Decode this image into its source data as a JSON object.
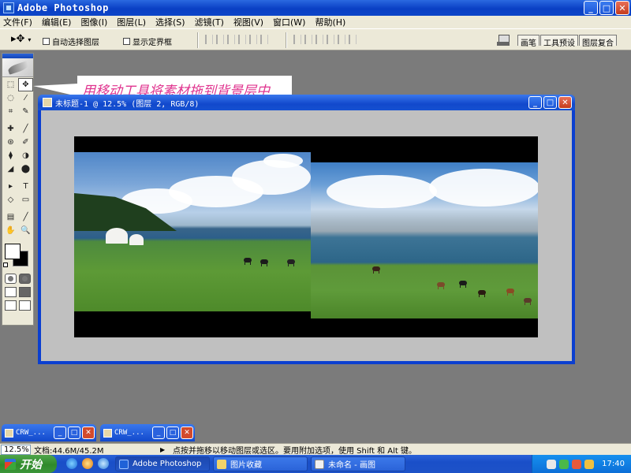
{
  "app": {
    "title": "Adobe Photoshop"
  },
  "window_buttons": {
    "minimize": "_",
    "maximize": "□",
    "close": "✕"
  },
  "menu": [
    "文件(F)",
    "编辑(E)",
    "图像(I)",
    "图层(L)",
    "选择(S)",
    "滤镜(T)",
    "视图(V)",
    "窗口(W)",
    "帮助(H)"
  ],
  "options_bar": {
    "tool_glyph": "▸✥",
    "dropdown_arrow": "▾",
    "auto_select_label": "自动选择图层",
    "show_bounds_label": "显示定界框",
    "dock_tabs": [
      "画笔",
      "工具预设",
      "图层复合"
    ]
  },
  "toolbox": {
    "tools": [
      "⬚",
      "✥",
      "◌",
      "⁄",
      "⌗",
      "✎",
      "✚",
      "╱",
      "⊛",
      "✐",
      "⧫",
      "◑",
      "◢",
      "⬤",
      "▸",
      "T",
      "◇",
      "▭",
      "▤",
      "╱",
      "✋",
      "🔍"
    ]
  },
  "annotation": {
    "text": "用移动工具将素材拖到背景层中"
  },
  "document": {
    "title": "未标题-1 @ 12.5% (图层 2, RGB/8)"
  },
  "minimized_docs": [
    {
      "title": "CRW_..."
    },
    {
      "title": "CRW_..."
    }
  ],
  "status_bar": {
    "zoom": "12.5%",
    "doc_size": "文档:44.6M/45.2M",
    "arrow": "▶",
    "hint": "点按并拖移以移动图层或选区。要用附加选项，使用 Shift 和 Alt 键。"
  },
  "taskbar": {
    "start_label": "开始",
    "tasks": [
      {
        "label": "Adobe Photoshop",
        "active": true
      },
      {
        "label": "图片收藏",
        "active": false
      },
      {
        "label": "未命名 - 画图",
        "active": false
      }
    ],
    "clock": "17:40"
  },
  "colors": {
    "xp_blue": "#0a3fc4",
    "canvas_gray": "#c0c0c0",
    "annotation_pink": "#e0348f",
    "workspace": "#7b7b7b"
  }
}
